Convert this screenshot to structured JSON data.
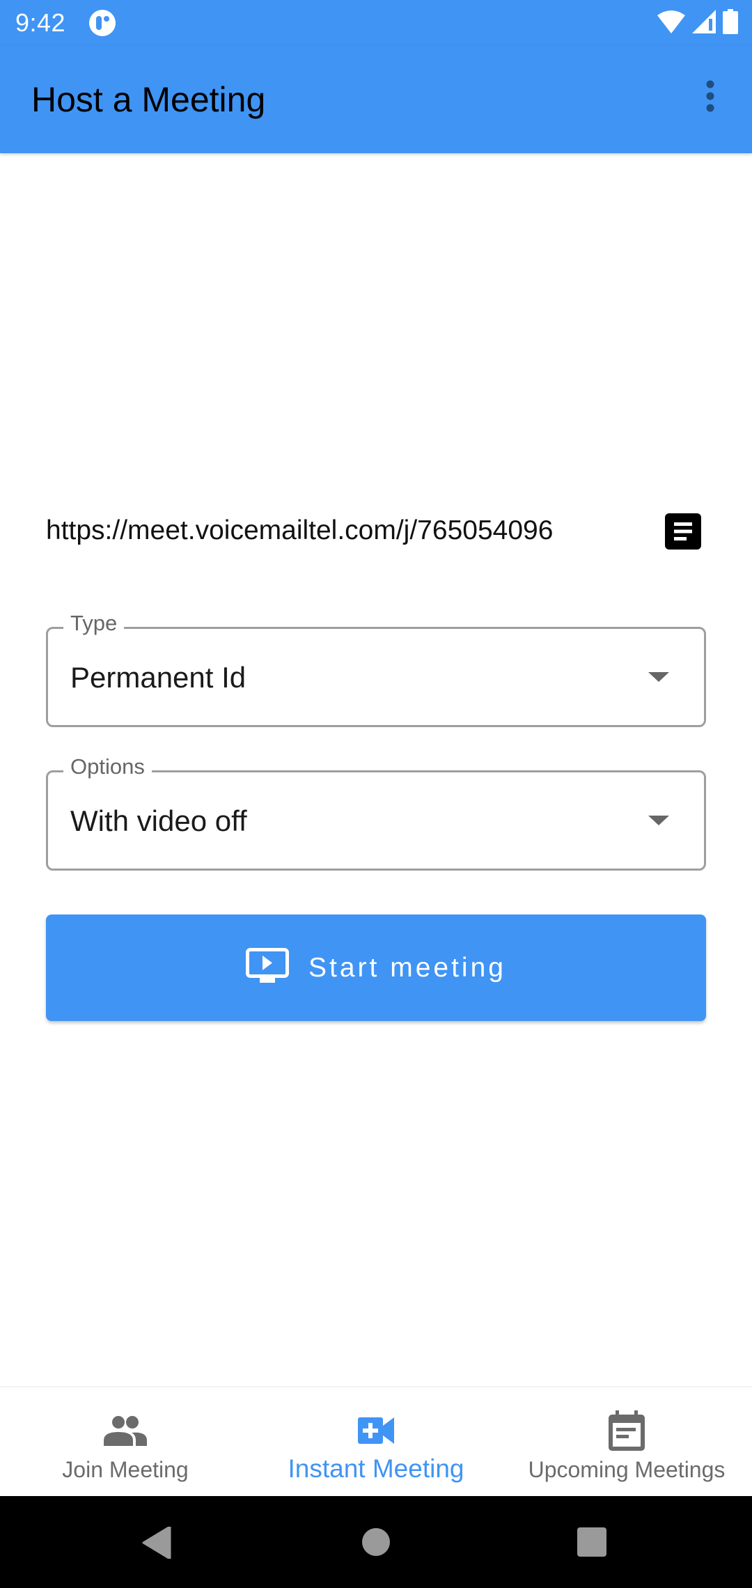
{
  "status_bar": {
    "time": "9:42",
    "icons": [
      "notification-app-icon",
      "wifi-icon",
      "signal-icon",
      "battery-icon"
    ]
  },
  "app_bar": {
    "title": "Host a Meeting",
    "overflow_icon": "more-vert-icon"
  },
  "meeting": {
    "link": "https://meet.voicemailtel.com/j/765054096",
    "copy_icon": "notes-icon"
  },
  "form": {
    "type": {
      "label": "Type",
      "value": "Permanent Id"
    },
    "options": {
      "label": "Options",
      "value": "With video off"
    },
    "start_button": {
      "label": "Start meeting",
      "icon": "present-to-screen-icon"
    }
  },
  "bottom_nav": {
    "items": [
      {
        "label": "Join Meeting",
        "icon": "people-icon",
        "active": false
      },
      {
        "label": "Instant Meeting",
        "icon": "video-call-icon",
        "active": true
      },
      {
        "label": "Upcoming Meetings",
        "icon": "calendar-icon",
        "active": false
      }
    ]
  },
  "system_nav": {
    "buttons": [
      "back",
      "home",
      "recents"
    ]
  },
  "colors": {
    "primary": "#4094f4",
    "inactive": "#6b6b6b",
    "border": "#9e9e9e",
    "text": "#1a1a1a"
  }
}
